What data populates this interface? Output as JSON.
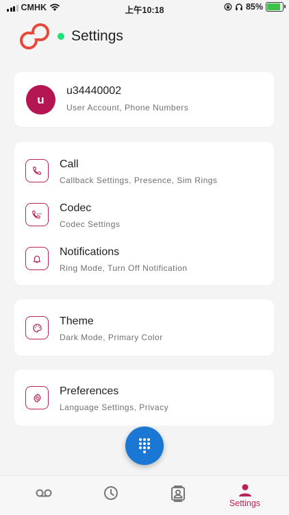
{
  "status_bar": {
    "carrier": "CMHK",
    "time": "上午10:18",
    "battery": "85%",
    "battery_level": 0.85
  },
  "header": {
    "title": "Settings",
    "presence_color": "#1ee07a"
  },
  "account": {
    "avatar_initial": "u",
    "username": "u34440002",
    "subtitle": "User Account, Phone Numbers"
  },
  "groups": [
    {
      "items": [
        {
          "icon": "phone-icon",
          "title": "Call",
          "subtitle": "Callback Settings, Presence, Sim Rings"
        },
        {
          "icon": "phone-dots-icon",
          "title": "Codec",
          "subtitle": "Codec Settings"
        },
        {
          "icon": "bell-icon",
          "title": "Notifications",
          "subtitle": "Ring Mode, Turn Off Notification"
        }
      ]
    },
    {
      "items": [
        {
          "icon": "palette-icon",
          "title": "Theme",
          "subtitle": "Dark Mode, Primary Color"
        }
      ]
    },
    {
      "items": [
        {
          "icon": "gear-icon",
          "title": "Preferences",
          "subtitle": "Language Settings, Privacy"
        }
      ]
    }
  ],
  "fab": {
    "icon": "dialpad-icon"
  },
  "tabbar": {
    "tabs": [
      {
        "icon": "voicemail-icon",
        "label": ""
      },
      {
        "icon": "clock-icon",
        "label": ""
      },
      {
        "icon": "contacts-icon",
        "label": ""
      },
      {
        "icon": "person-icon",
        "label": "Settings",
        "active": true
      }
    ]
  },
  "colors": {
    "accent": "#b8245a",
    "avatar": "#b41553",
    "fab": "#1a78d4",
    "background": "#f4f4f4"
  }
}
